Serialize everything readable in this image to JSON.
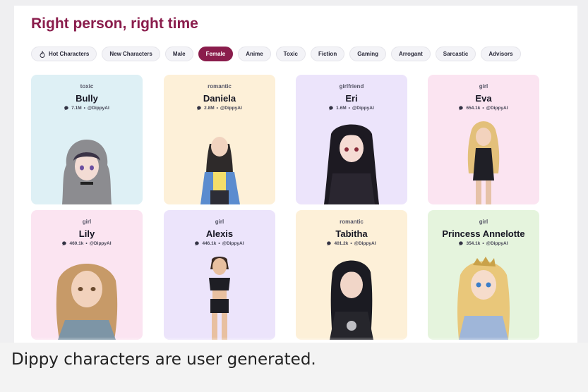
{
  "header": {
    "title": "Right person, right time"
  },
  "filters": [
    {
      "label": "Hot Characters",
      "active": false,
      "icon": "fire-icon"
    },
    {
      "label": "New Characters",
      "active": false
    },
    {
      "label": "Male",
      "active": false
    },
    {
      "label": "Female",
      "active": true
    },
    {
      "label": "Anime",
      "active": false
    },
    {
      "label": "Toxic",
      "active": false
    },
    {
      "label": "Fiction",
      "active": false
    },
    {
      "label": "Gaming",
      "active": false
    },
    {
      "label": "Arrogant",
      "active": false
    },
    {
      "label": "Sarcastic",
      "active": false
    },
    {
      "label": "Advisors",
      "active": false
    }
  ],
  "cards": [
    {
      "tag": "toxic",
      "name": "Bully",
      "count": "7.1M",
      "author": "@DippyAI",
      "bg": "#def0f5"
    },
    {
      "tag": "romantic",
      "name": "Daniela",
      "count": "2.8M",
      "author": "@DippyAI",
      "bg": "#fdf0d8"
    },
    {
      "tag": "girlfriend",
      "name": "Eri",
      "count": "1.6M",
      "author": "@DippyAI",
      "bg": "#ece4fb"
    },
    {
      "tag": "girl",
      "name": "Eva",
      "count": "654.1k",
      "author": "@DippyAI",
      "bg": "#fbe4f1"
    },
    {
      "tag": "girl",
      "name": "Lily",
      "count": "460.1k",
      "author": "@DippyAI",
      "bg": "#fbe4f1"
    },
    {
      "tag": "girl",
      "name": "Alexis",
      "count": "446.1k",
      "author": "@DippyAI",
      "bg": "#ece4fb"
    },
    {
      "tag": "romantic",
      "name": "Tabitha",
      "count": "401.2k",
      "author": "@DippyAI",
      "bg": "#fdf0d8"
    },
    {
      "tag": "girl",
      "name": "Princess Annelotte",
      "count": "354.1k",
      "author": "@DippyAI",
      "bg": "#e5f4dd"
    }
  ],
  "caption": "Dippy characters are user generated.",
  "colors": {
    "accent": "#8a1d4c"
  }
}
